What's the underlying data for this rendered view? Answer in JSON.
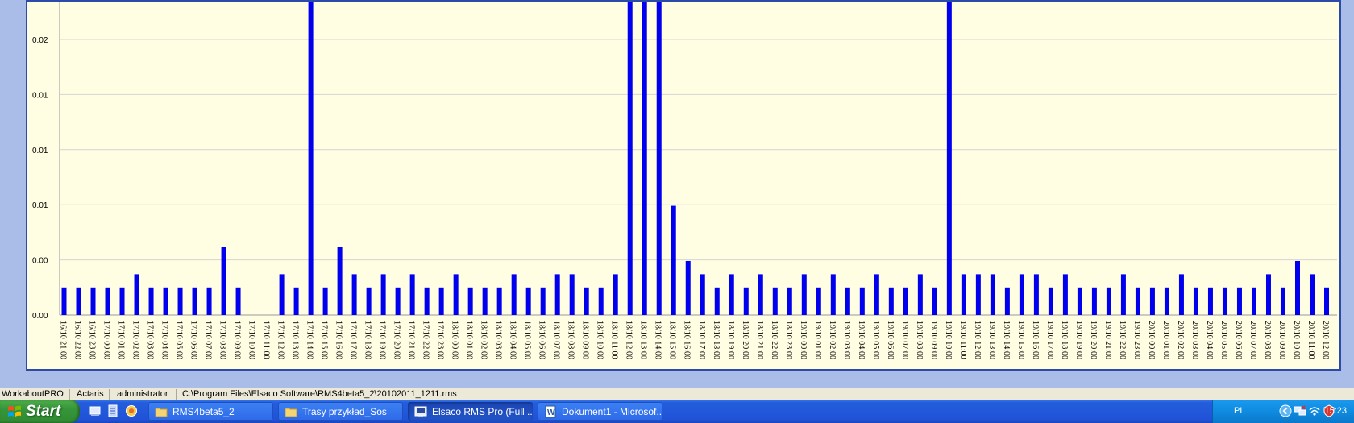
{
  "colors": {
    "bar": "#0000ee",
    "plot_bg": "#fffee3",
    "grid": "#d4d4d4",
    "taskbar": "#245edc",
    "start": "#36963a",
    "tray": "#0f8bdf"
  },
  "chart_data": {
    "type": "bar",
    "title": "",
    "xlabel": "",
    "ylabel": "",
    "grid": true,
    "ylim": [
      0,
      0.0275
    ],
    "y_tick_labels": [
      "0.02",
      "0.01",
      "0.01",
      "0.01",
      "0.00",
      "0.00"
    ],
    "y_tick_values": [
      0.025,
      0.02,
      0.015,
      0.01,
      0.005,
      0.0
    ],
    "categories": [
      "16/10 21:00",
      "16/10 22:00",
      "16/10 23:00",
      "17/10 00:00",
      "17/10 01:00",
      "17/10 02:00",
      "17/10 03:00",
      "17/10 04:00",
      "17/10 05:00",
      "17/10 06:00",
      "17/10 07:00",
      "17/10 08:00",
      "17/10 09:00",
      "17/10 10:00",
      "17/10 11:00",
      "17/10 12:00",
      "17/10 13:00",
      "17/10 14:00",
      "17/10 15:00",
      "17/10 16:00",
      "17/10 17:00",
      "17/10 18:00",
      "17/10 19:00",
      "17/10 20:00",
      "17/10 21:00",
      "17/10 22:00",
      "17/10 23:00",
      "18/10 00:00",
      "18/10 01:00",
      "18/10 02:00",
      "18/10 03:00",
      "18/10 04:00",
      "18/10 05:00",
      "18/10 06:00",
      "18/10 07:00",
      "18/10 08:00",
      "18/10 09:00",
      "18/10 10:00",
      "18/10 11:00",
      "18/10 12:00",
      "18/10 13:00",
      "18/10 14:00",
      "18/10 15:00",
      "18/10 16:00",
      "18/10 17:00",
      "18/10 18:00",
      "18/10 19:00",
      "18/10 20:00",
      "18/10 21:00",
      "18/10 22:00",
      "18/10 23:00",
      "19/10 00:00",
      "19/10 01:00",
      "19/10 02:00",
      "19/10 03:00",
      "19/10 04:00",
      "19/10 05:00",
      "19/10 06:00",
      "19/10 07:00",
      "19/10 08:00",
      "19/10 09:00",
      "19/10 10:00",
      "19/10 11:00",
      "19/10 12:00",
      "19/10 13:00",
      "19/10 14:00",
      "19/10 15:00",
      "19/10 16:00",
      "19/10 17:00",
      "19/10 18:00",
      "19/10 19:00",
      "19/10 20:00",
      "19/10 21:00",
      "19/10 22:00",
      "19/10 23:00",
      "20/10 00:00",
      "20/10 01:00",
      "20/10 02:00",
      "20/10 03:00",
      "20/10 04:00",
      "20/10 05:00",
      "20/10 06:00",
      "20/10 07:00",
      "20/10 08:00",
      "20/10 09:00",
      "20/10 10:00",
      "20/10 11:00",
      "20/10 12:00"
    ],
    "values": [
      0.0025,
      0.0025,
      0.0025,
      0.0025,
      0.0025,
      0.0037,
      0.0025,
      0.0025,
      0.0025,
      0.0025,
      0.0025,
      0.0062,
      0.0025,
      0,
      0,
      0.0037,
      0.0025,
      0.03,
      0.0025,
      0.0062,
      0.0037,
      0.0025,
      0.0037,
      0.0025,
      0.0037,
      0.0025,
      0.0025,
      0.0037,
      0.0025,
      0.0025,
      0.0025,
      0.0037,
      0.0025,
      0.0025,
      0.0037,
      0.0037,
      0.0025,
      0.0025,
      0.0037,
      0.03,
      0.03,
      0.03,
      0.0099,
      0.0049,
      0.0037,
      0.0025,
      0.0037,
      0.0025,
      0.0037,
      0.0025,
      0.0025,
      0.0037,
      0.0025,
      0.0037,
      0.0025,
      0.0025,
      0.0037,
      0.0025,
      0.0025,
      0.0037,
      0.0025,
      0.03,
      0.0037,
      0.0037,
      0.0037,
      0.0025,
      0.0037,
      0.0037,
      0.0025,
      0.0037,
      0.0025,
      0.0025,
      0.0025,
      0.0037,
      0.0025,
      0.0025,
      0.0025,
      0.0037,
      0.0025,
      0.0025,
      0.0025,
      0.0025,
      0.0025,
      0.0037,
      0.0025,
      0.0049,
      0.0037,
      0.0025
    ]
  },
  "status_bar": {
    "device": "WorkaboutPRO",
    "manufacturer": "Actaris",
    "user": "administrator",
    "file_path": "C:\\Program Files\\Elsaco Software\\RMS4beta5_2\\20102011_1211.rms"
  },
  "taskbar": {
    "start_label": "Start",
    "buttons": [
      {
        "label": "RMS4beta5_2",
        "icon": "folder-icon"
      },
      {
        "label": "Trasy przykład_Sos",
        "icon": "folder-icon"
      },
      {
        "label": "Elsaco RMS Pro (Full ...",
        "icon": "app-icon"
      },
      {
        "label": "Dokument1 - Microsof...",
        "icon": "word-icon"
      }
    ],
    "quick_launch": [
      "show-desktop-icon",
      "notepad-icon",
      "browser-icon"
    ],
    "tray": {
      "language": "PL",
      "clock": "15:23",
      "icons": [
        "chevron-left-icon",
        "network-icon",
        "wireless-icon",
        "security-icon"
      ]
    }
  }
}
